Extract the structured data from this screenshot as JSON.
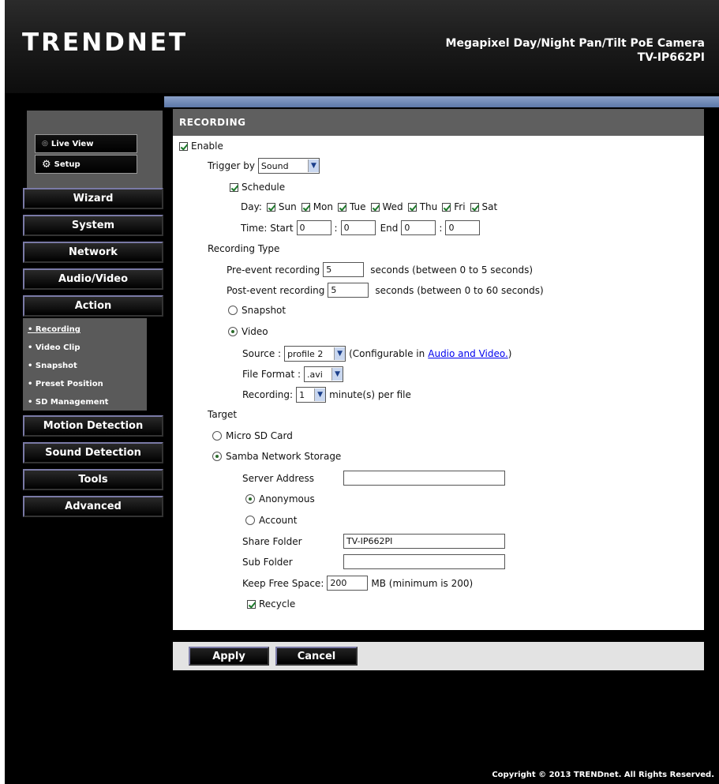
{
  "header": {
    "logo": "TRENDNET",
    "product_line1": "Megapixel Day/Night Pan/Tilt PoE Camera",
    "product_line2": "TV-IP662PI"
  },
  "sidebar": {
    "top_buttons": {
      "live_view": "Live View",
      "setup": "Setup"
    },
    "nav": {
      "wizard": "Wizard",
      "system": "System",
      "network": "Network",
      "audio_video": "Audio/Video",
      "action": "Action",
      "motion_detection": "Motion Detection",
      "sound_detection": "Sound Detection",
      "tools": "Tools",
      "advanced": "Advanced"
    },
    "subnav": [
      "• Recording",
      "• Video Clip",
      "• Snapshot",
      "• Preset Position",
      "• SD Management"
    ]
  },
  "content": {
    "title": "RECORDING",
    "enable_label": "Enable",
    "trigger_label": "Trigger by",
    "trigger_value": "Sound",
    "schedule_label": "Schedule",
    "day_label": "Day:",
    "days": [
      "Sun",
      "Mon",
      "Tue",
      "Wed",
      "Thu",
      "Fri",
      "Sat"
    ],
    "time_label": "Time: Start",
    "colon": ":",
    "end_label": "End",
    "start_hour": "0",
    "start_min": "0",
    "end_hour": "0",
    "end_min": "0",
    "recording_type_label": "Recording Type",
    "pre_event_label": "Pre-event recording",
    "pre_event_value": "5",
    "pre_event_hint": "seconds (between 0 to 5 seconds)",
    "post_event_label": "Post-event recording",
    "post_event_value": "5",
    "post_event_hint": "seconds (between 0 to 60 seconds)",
    "snapshot_label": "Snapshot",
    "video_label": "Video",
    "source_label": "Source :",
    "source_value": "profile 2",
    "source_hint": "(Configurable in",
    "source_link": "Audio and Video.",
    "source_hint_end": ")",
    "file_format_label": "File Format :",
    "file_format_value": ".avi",
    "recording_label": "Recording:",
    "recording_value": "1",
    "recording_hint": "minute(s) per file",
    "target_label": "Target",
    "micro_sd_label": "Micro SD Card",
    "samba_label": "Samba Network Storage",
    "server_address_label": "Server Address",
    "server_address_value": "",
    "anonymous_label": "Anonymous",
    "account_label": "Account",
    "share_folder_label": "Share Folder",
    "share_folder_value": "TV-IP662PI",
    "sub_folder_label": "Sub Folder",
    "sub_folder_value": "",
    "keep_free_label": "Keep Free Space:",
    "keep_free_value": "200",
    "keep_free_hint": "MB (minimum is 200)",
    "recycle_label": "Recycle"
  },
  "actions": {
    "apply": "Apply",
    "cancel": "Cancel"
  },
  "footer": {
    "copyright": "Copyright © 2013 TRENDnet. All Rights Reserved."
  }
}
